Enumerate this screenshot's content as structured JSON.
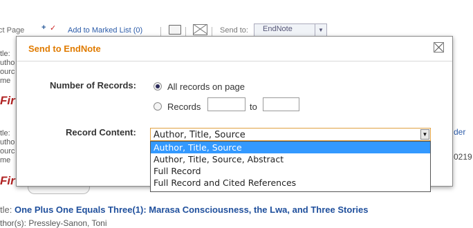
{
  "toolbar": {
    "select_page_fragment": "ct Page",
    "add_to_marked_list": "Add to Marked List (0)",
    "send_to_label": "Send to:",
    "send_to_value": "EndNote"
  },
  "background": {
    "left_fragments": [
      "tle:",
      "utho",
      "ourc",
      "me"
    ],
    "left_fragments_2": [
      "tle:",
      "utho",
      "ourc",
      "me"
    ],
    "find_fragment": "Fir",
    "right_link_fragment": "der",
    "right_number_fragment": "0219",
    "record_title_prefix": "tle:",
    "record_title": "One Plus One Equals Three(1): Marasa Consciousness, the Lwa, and Three Stories",
    "record_author": "thor(s): Pressley-Sanon, Toni"
  },
  "modal": {
    "title": "Send to EndNote",
    "number_of_records_label": "Number of Records:",
    "option_all": "All records on page",
    "option_records": "Records",
    "range_to": "to",
    "range_from_value": "",
    "range_to_value": "",
    "record_content_label": "Record Content:",
    "record_content_selected": "Author, Title, Source",
    "record_content_options": [
      "Author, Title, Source",
      "Author, Title, Source, Abstract",
      "Full Record",
      "Full Record and Cited References"
    ]
  },
  "colors": {
    "modal_title": "#e07b00",
    "selected_option_bg": "#3399ff",
    "link_blue": "#1f4f9c",
    "find_red": "#b02222"
  }
}
